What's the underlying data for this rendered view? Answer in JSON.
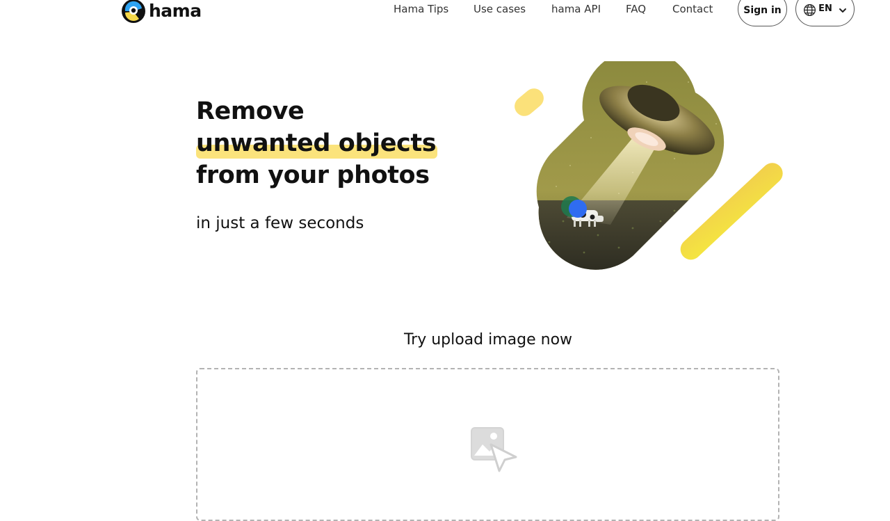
{
  "brand": {
    "name": "hama",
    "colors": {
      "accent_yellow": "#fbe37c",
      "logo_blue": "#2ea3f2",
      "logo_yellow": "#f7d94a"
    }
  },
  "nav": {
    "items": [
      {
        "label": "Hama Tips"
      },
      {
        "label": "Use cases"
      },
      {
        "label": "hama API"
      },
      {
        "label": "FAQ"
      },
      {
        "label": "Contact"
      }
    ],
    "sign_in_label": "Sign in",
    "language": {
      "code": "EN",
      "icon": "globe-icon"
    }
  },
  "hero": {
    "title_line1": "Remove",
    "title_line2": "unwanted objects",
    "title_line3": "from your photos",
    "subtitle": "in just a few seconds",
    "image": "ufo-abducting-cow-illustration"
  },
  "upload": {
    "heading": "Try upload image now",
    "icon": "image-upload-icon"
  }
}
